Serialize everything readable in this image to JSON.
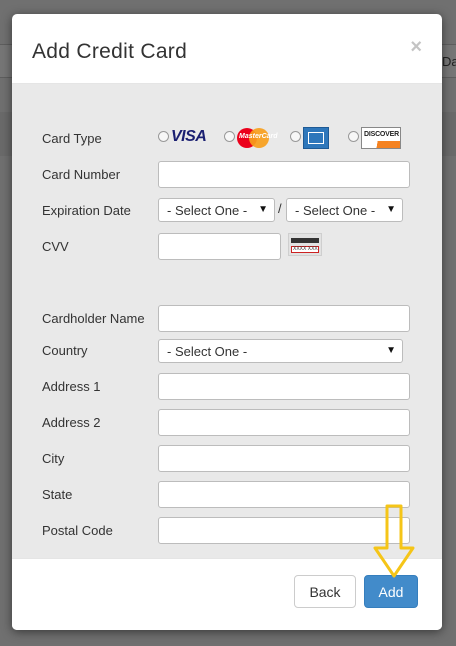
{
  "background": {
    "edge_text": "Da"
  },
  "modal": {
    "title": "Add Credit Card",
    "close_glyph": "×",
    "fields": {
      "card_type": {
        "label": "Card Type",
        "options": [
          "VISA",
          "MasterCard",
          "American Express",
          "DISCOVER"
        ]
      },
      "card_number": {
        "label": "Card Number",
        "value": ""
      },
      "expiration": {
        "label": "Expiration Date",
        "month_value": "- Select One -",
        "separator": "/",
        "year_value": "- Select One -"
      },
      "cvv": {
        "label": "CVV",
        "value": "",
        "card_text": "XXXX XXX"
      },
      "cardholder_name": {
        "label": "Cardholder Name",
        "value": ""
      },
      "country": {
        "label": "Country",
        "value": "- Select One -"
      },
      "address1": {
        "label": "Address 1",
        "value": ""
      },
      "address2": {
        "label": "Address 2",
        "value": ""
      },
      "city": {
        "label": "City",
        "value": ""
      },
      "state": {
        "label": "State",
        "value": ""
      },
      "postal_code": {
        "label": "Postal Code",
        "value": ""
      }
    },
    "footer": {
      "back_label": "Back",
      "add_label": "Add"
    }
  },
  "colors": {
    "primary_button": "#428bca",
    "body_background": "#e9e9e9",
    "highlight_arrow": "#f5c518"
  },
  "icons": {
    "dropdown": "triangle-down",
    "card_logos": [
      "visa-logo",
      "mastercard-logo",
      "amex-logo",
      "discover-logo"
    ],
    "cvv_hint": "card-back-cvv-icon",
    "annotation": "down-arrow-icon"
  }
}
